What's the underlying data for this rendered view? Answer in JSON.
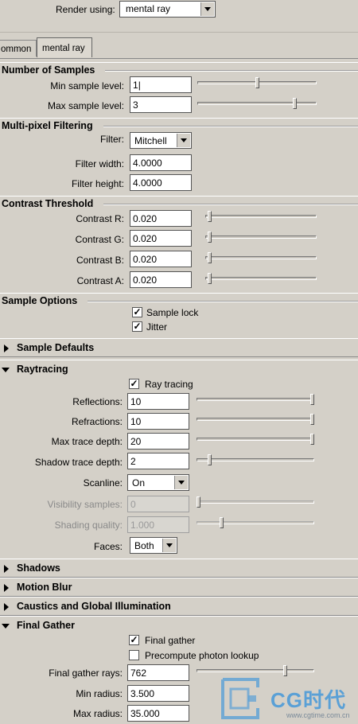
{
  "render": {
    "label": "Render using:",
    "value": "mental ray"
  },
  "tabs": [
    {
      "label": "ommon"
    },
    {
      "label": "mental ray"
    }
  ],
  "sections": {
    "samples": "Number of Samples",
    "filtering": "Multi-pixel Filtering",
    "contrast": "Contrast Threshold",
    "options": "Sample Options",
    "defaults": "Sample Defaults",
    "raytracing": "Raytracing",
    "shadows": "Shadows",
    "motion": "Motion Blur",
    "caustics": "Caustics and Global Illumination",
    "finalgather": "Final Gather"
  },
  "samples": {
    "min_label": "Min sample level:",
    "min_value": "1",
    "min_level": 0.5,
    "max_label": "Max sample level:",
    "max_value": "3",
    "max_level": 0.83
  },
  "filtering": {
    "filter_label": "Filter:",
    "filter_value": "Mitchell",
    "width_label": "Filter width:",
    "width_value": "4.0000",
    "height_label": "Filter height:",
    "height_value": "4.0000"
  },
  "contrast": {
    "r_label": "Contrast R:",
    "r_value": "0.020",
    "g_label": "Contrast G:",
    "g_value": "0.020",
    "b_label": "Contrast B:",
    "b_value": "0.020",
    "a_label": "Contrast A:",
    "a_value": "0.020",
    "level": 0.02
  },
  "options": {
    "lock_label": "Sample lock",
    "lock_checked": true,
    "jitter_label": "Jitter",
    "jitter_checked": true
  },
  "raytracing": {
    "toggle_label": "Ray tracing",
    "toggle_checked": true,
    "reflections_label": "Reflections:",
    "reflections_value": "10",
    "reflections_level": 1.0,
    "refractions_label": "Refractions:",
    "refractions_value": "10",
    "refractions_level": 1.0,
    "maxdepth_label": "Max trace depth:",
    "maxdepth_value": "20",
    "maxdepth_level": 1.0,
    "shadowdepth_label": "Shadow trace depth:",
    "shadowdepth_value": "2",
    "shadowdepth_level": 0.1,
    "scanline_label": "Scanline:",
    "scanline_value": "On",
    "visibility_label": "Visibility samples:",
    "visibility_value": "0",
    "visibility_level": 0.0,
    "shading_label": "Shading quality:",
    "shading_value": "1.000",
    "shading_level": 0.2,
    "faces_label": "Faces:",
    "faces_value": "Both"
  },
  "finalgather": {
    "toggle_label": "Final gather",
    "toggle_checked": true,
    "precompute_label": "Precompute photon lookup",
    "precompute_checked": false,
    "rays_label": "Final gather rays:",
    "rays_value": "762",
    "rays_level": 0.76,
    "min_label": "Min radius:",
    "min_value": "3.500",
    "max_label": "Max radius:",
    "max_value": "35.000"
  },
  "watermark": {
    "brand": "CG时代",
    "url": "www.cgtime.com.cn"
  },
  "colors": {
    "panel": "#d4d0c8",
    "field": "#ffffff",
    "watermark": "#5aa0d6"
  },
  "icons": {
    "check": "✓",
    "expand_collapsed": "triangle-right",
    "expand_open": "triangle-down",
    "dropdown": "triangle-down"
  }
}
